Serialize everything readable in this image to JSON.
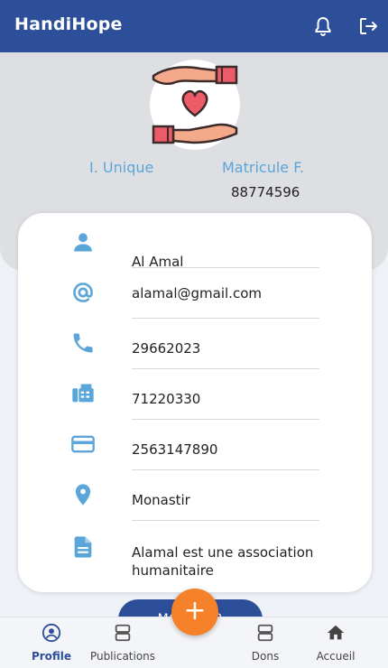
{
  "app": {
    "title": "HandiHope"
  },
  "profile": {
    "id_unique_label": "I. Unique",
    "matricule_label": "Matricule F.",
    "matricule_value": "88774596",
    "name": "Al Amal",
    "email": "alamal@gmail.com",
    "phone": "29662023",
    "fax": "71220330",
    "card": "2563147890",
    "location": "Monastir",
    "description_line1": "Alamal est une association",
    "description_line2": "humanitaire"
  },
  "actions": {
    "modify_label": "MODIFIER",
    "fab_label": "+"
  },
  "nav": {
    "items": [
      {
        "label": "Profile",
        "active": true
      },
      {
        "label": "Publications",
        "active": false
      },
      {
        "label": "Dons",
        "active": false
      },
      {
        "label": "Accueil",
        "active": false
      }
    ]
  },
  "colors": {
    "primary": "#2d4f9a",
    "accent": "#f5822a",
    "icon": "#5aa6d8",
    "heart": "#ec5b67"
  }
}
